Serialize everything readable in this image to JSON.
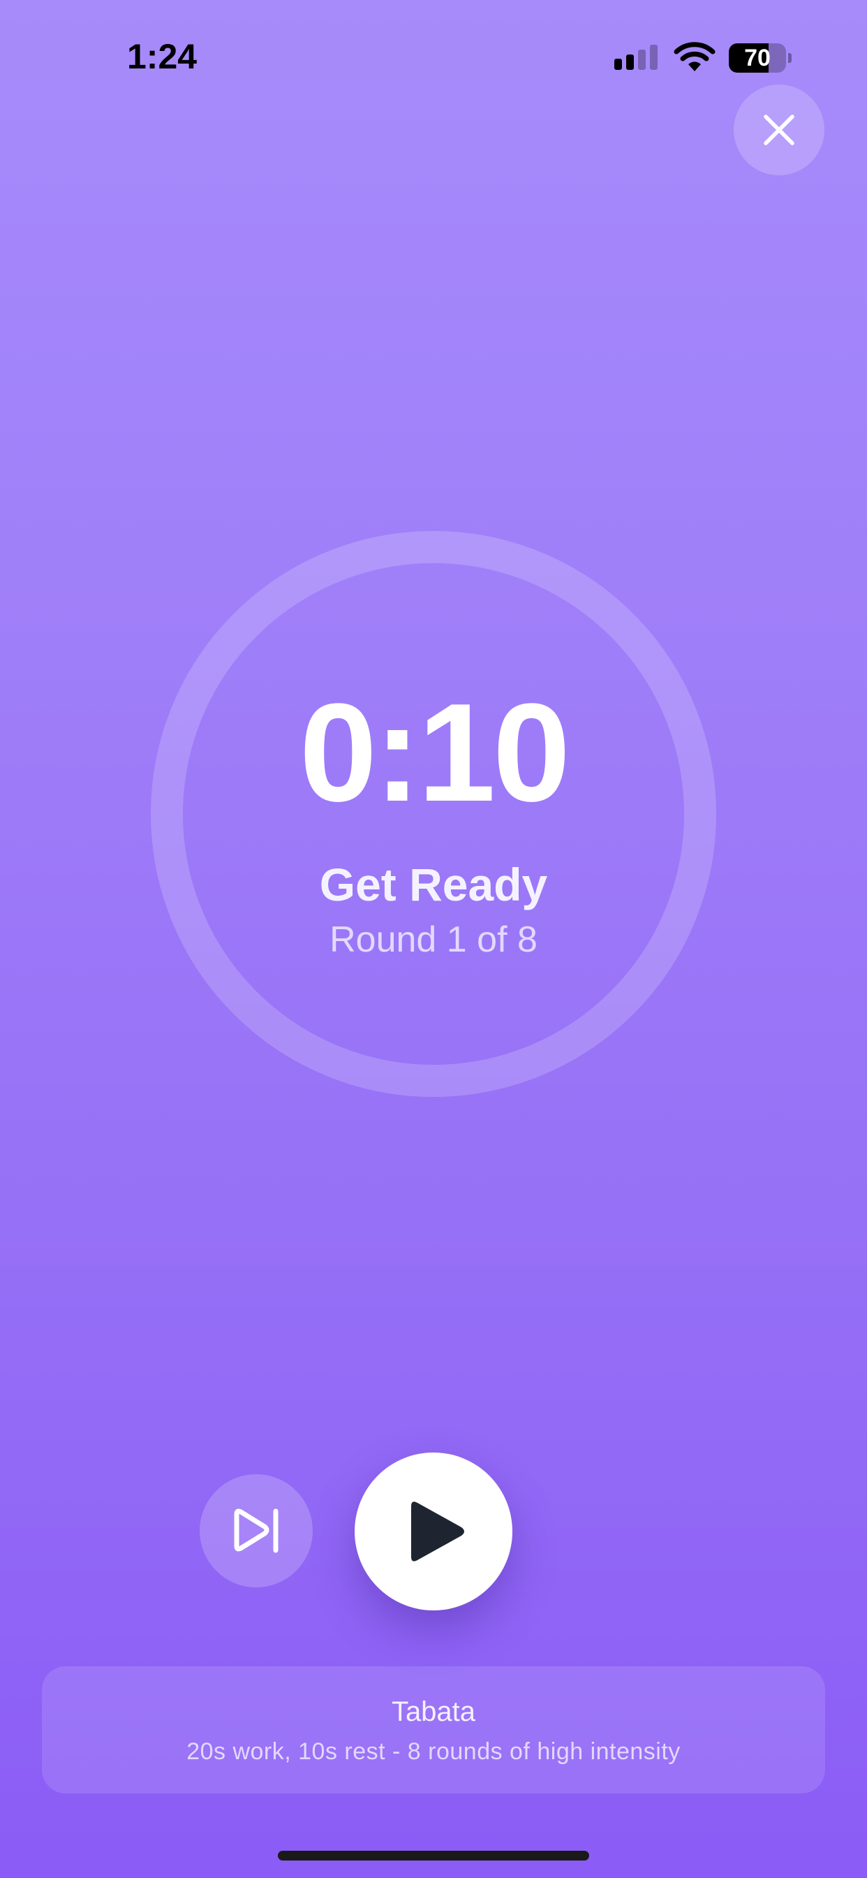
{
  "status_bar": {
    "time": "1:24",
    "battery_level": "70",
    "battery_fraction": 0.7,
    "icons": [
      "signal-icon",
      "wifi-icon",
      "battery-icon"
    ]
  },
  "header": {
    "close_icon": "close-icon"
  },
  "timer": {
    "time": "0:10",
    "phase": "Get Ready",
    "round": "Round 1 of 8"
  },
  "controls": {
    "skip_icon": "skip-forward-icon",
    "play_icon": "play-icon"
  },
  "workout": {
    "name": "Tabata",
    "description": "20s work, 10s rest - 8 rounds of high intensity"
  },
  "colors": {
    "background_top": "#A78BFA",
    "background_bottom": "#8B5CF6",
    "play_icon": "#1E2530",
    "text_primary": "#FFFFFF"
  }
}
